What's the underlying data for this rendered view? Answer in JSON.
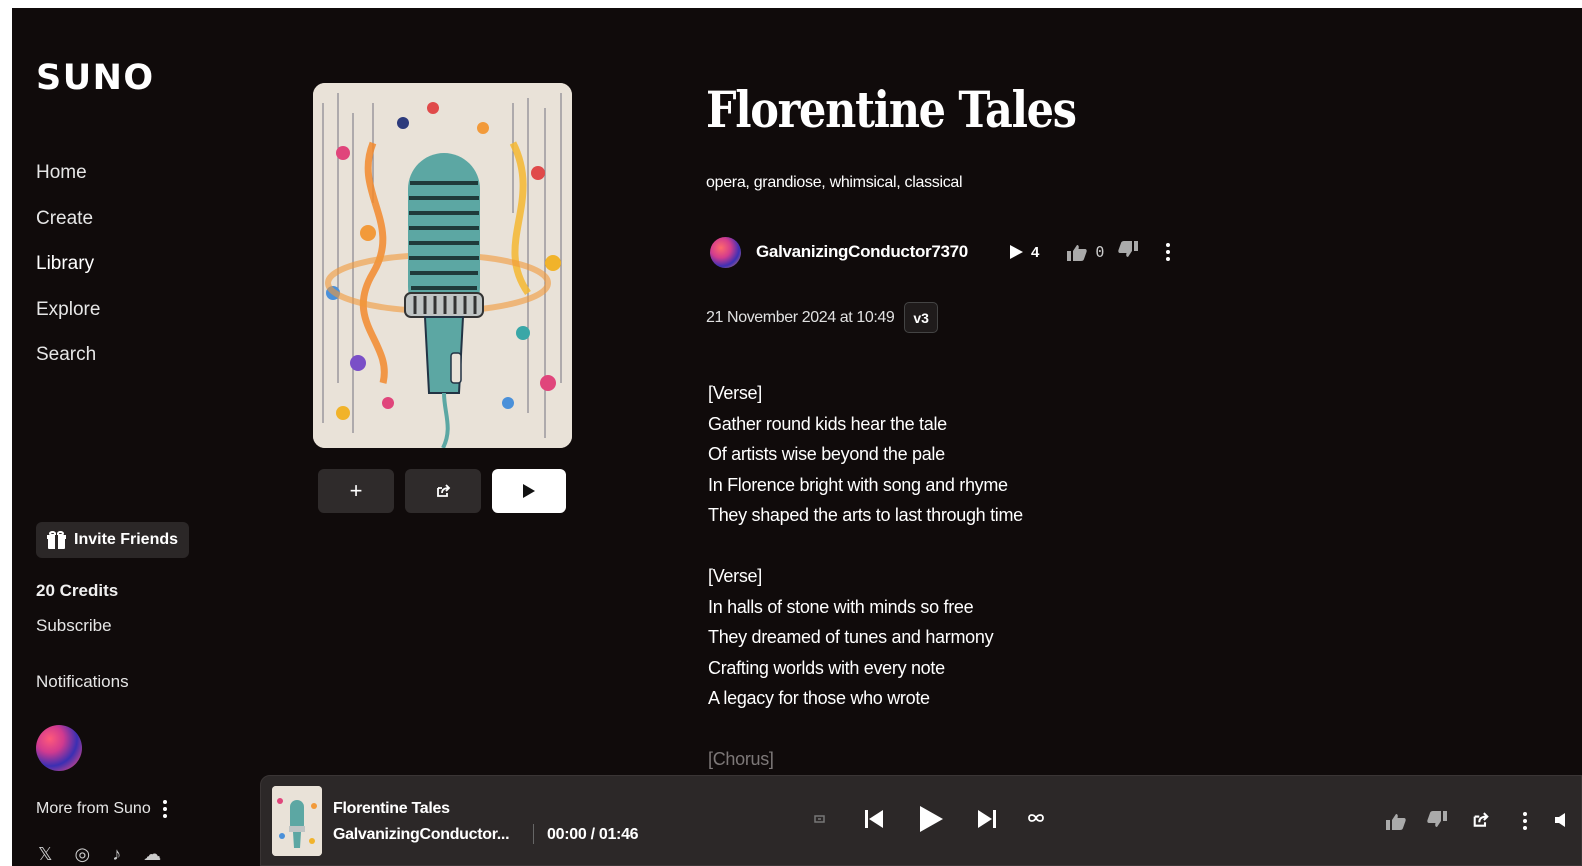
{
  "app": {
    "logo": "SUNO"
  },
  "sidebar": {
    "nav": [
      {
        "label": "Home"
      },
      {
        "label": "Create"
      },
      {
        "label": "Library"
      },
      {
        "label": "Explore"
      },
      {
        "label": "Search"
      }
    ],
    "invite_label": "Invite Friends",
    "credits": "20 Credits",
    "subscribe": "Subscribe",
    "notifications": "Notifications",
    "more_label": "More from Suno",
    "socials": [
      "X",
      "instagram",
      "tiktok",
      "discord"
    ]
  },
  "song": {
    "title": "Florentine Tales",
    "tags": "opera, grandiose, whimsical, classical",
    "author": "GalvanizingConductor7370",
    "play_count": "4",
    "like_count": "0",
    "date": "21 November 2024 at 10:49",
    "version": "v3",
    "lyrics": [
      "[Verse]",
      "Gather round kids hear the tale",
      "Of artists wise beyond the pale",
      "In Florence bright with song and rhyme",
      "They shaped the arts to last through time",
      "",
      "[Verse]",
      "In halls of stone with minds so free",
      "They dreamed of tunes and harmony",
      "Crafting worlds with every note",
      "A legacy for those who wrote",
      "",
      "[Chorus]"
    ]
  },
  "cover_buttons": {
    "add": "+",
    "share": "share-icon",
    "play": "play-icon"
  },
  "player": {
    "title": "Florentine Tales",
    "artist": "GalvanizingConductor...",
    "time": "00:00 / 01:46"
  },
  "colors": {
    "background": "#100b0b",
    "player_bg": "#2c2828",
    "button_bg": "#2f2b2b"
  }
}
